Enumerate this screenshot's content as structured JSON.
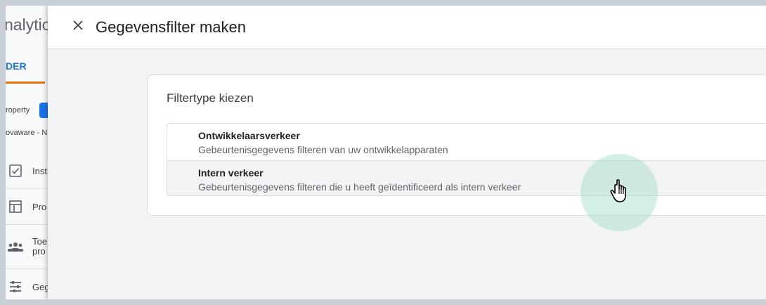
{
  "background_app": {
    "logo_text": "nalytic",
    "tab_label": "DER",
    "property_label": "roperty",
    "account_label": "ovaware - N",
    "nav_items": [
      {
        "label": "Inst",
        "icon": "checklist-icon"
      },
      {
        "label": "Pro",
        "icon": "layout-icon"
      },
      {
        "label": "Toe",
        "label2": "pro",
        "icon": "people-icon"
      },
      {
        "label": "Geg",
        "icon": "filter-sliders-icon"
      }
    ]
  },
  "panel": {
    "title": "Gegevensfilter maken",
    "close_icon": "close-icon"
  },
  "card": {
    "title": "Filtertype kiezen",
    "options": [
      {
        "title": "Ontwikkelaarsverkeer",
        "description": "Gebeurtenisgegevens filteren van uw ontwikkelapparaten"
      },
      {
        "title": "Intern verkeer",
        "description": "Gebeurtenisgegevens filteren die u heeft geïdentificeerd als intern verkeer"
      }
    ]
  },
  "colors": {
    "accent": "#1a73e8",
    "tab_underline": "#e8710a",
    "panel_bg": "#f1f3f4",
    "click_ring": "#a0dcc8"
  }
}
